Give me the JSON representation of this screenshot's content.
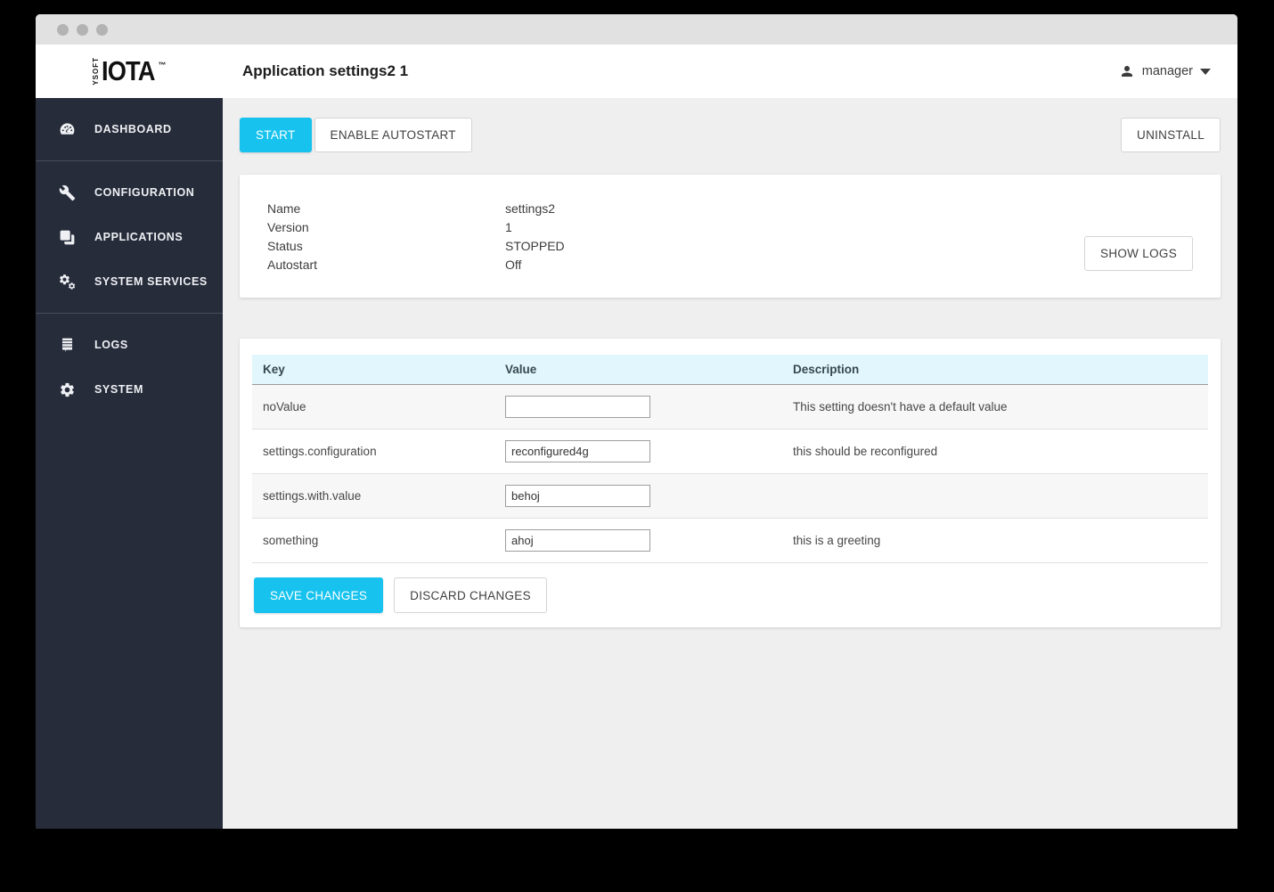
{
  "header": {
    "logo": {
      "brand": "YSOFT",
      "name": "IOTA",
      "tm": "™"
    },
    "page_title": "Application settings2 1",
    "user_menu": {
      "label": "manager"
    }
  },
  "sidebar": {
    "groups": [
      {
        "items": [
          {
            "label": "DASHBOARD",
            "icon": "dashboard-icon"
          }
        ]
      },
      {
        "items": [
          {
            "label": "CONFIGURATION",
            "icon": "wrench-icon"
          },
          {
            "label": "APPLICATIONS",
            "icon": "applications-icon"
          },
          {
            "label": "SYSTEM SERVICES",
            "icon": "gears-icon"
          }
        ]
      },
      {
        "items": [
          {
            "label": "LOGS",
            "icon": "logs-icon"
          },
          {
            "label": "SYSTEM",
            "icon": "gear-icon"
          }
        ]
      }
    ]
  },
  "toolbar": {
    "start_label": "START",
    "enable_autostart_label": "ENABLE AUTOSTART",
    "uninstall_label": "UNINSTALL"
  },
  "app_info": {
    "fields": [
      {
        "label": "Name",
        "value": "settings2"
      },
      {
        "label": "Version",
        "value": "1"
      },
      {
        "label": "Status",
        "value": "STOPPED"
      },
      {
        "label": "Autostart",
        "value": "Off"
      }
    ],
    "show_logs_label": "SHOW LOGS"
  },
  "settings_table": {
    "columns": [
      "Key",
      "Value",
      "Description"
    ],
    "rows": [
      {
        "key": "noValue",
        "value": "",
        "description": "This setting doesn't have a default value"
      },
      {
        "key": "settings.configuration",
        "value": "reconfigured4g",
        "description": "this should be reconfigured"
      },
      {
        "key": "settings.with.value",
        "value": "behoj",
        "description": ""
      },
      {
        "key": "something",
        "value": "ahoj",
        "description": "this is a greeting"
      }
    ],
    "save_label": "SAVE CHANGES",
    "discard_label": "DISCARD CHANGES"
  },
  "colors": {
    "accent": "#17c3ee",
    "sidebar_bg": "#262c3a",
    "table_header_bg": "#e2f7fd",
    "window_titlebar": "#e1e1e1",
    "main_bg": "#efefef"
  }
}
